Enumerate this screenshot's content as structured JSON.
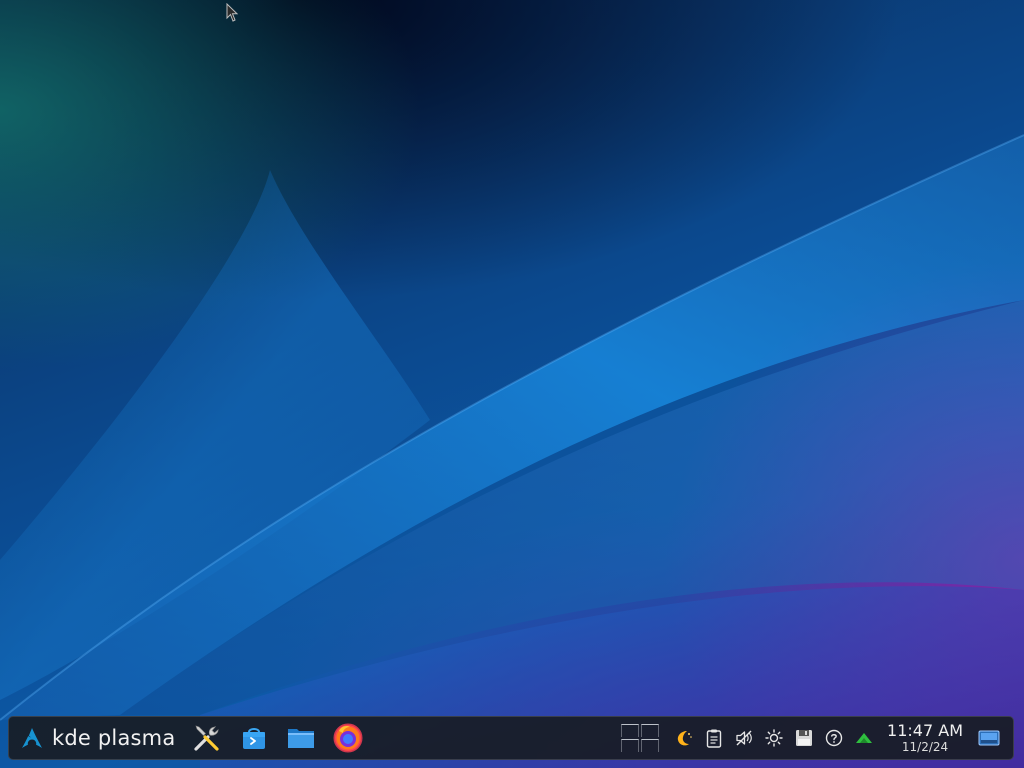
{
  "desktop": {
    "wallpaper": "kde-plasma-default-wallpaper",
    "colors": {
      "deep_blue": "#0b4a90",
      "bright_blue": "#1a8fe6",
      "teal": "#14786e",
      "magenta": "#961eaa"
    }
  },
  "taskbar": {
    "launcher": {
      "icon": "arch-linux-logo-icon",
      "label": "kde plasma"
    },
    "pinned_apps": [
      {
        "name": "system-settings",
        "icon": "wrench-screwdriver-icon"
      },
      {
        "name": "discover",
        "icon": "shopping-bag-icon"
      },
      {
        "name": "file-manager",
        "icon": "folder-icon"
      },
      {
        "name": "firefox",
        "icon": "firefox-icon"
      }
    ],
    "pager": {
      "desktops": 4
    },
    "tray": [
      {
        "name": "night-color",
        "icon": "moon-icon"
      },
      {
        "name": "clipboard",
        "icon": "clipboard-icon"
      },
      {
        "name": "volume-muted",
        "icon": "speaker-muted-icon"
      },
      {
        "name": "brightness",
        "icon": "sun-icon"
      },
      {
        "name": "storage",
        "icon": "floppy-disk-icon"
      },
      {
        "name": "help",
        "icon": "question-circle-icon"
      },
      {
        "name": "network",
        "icon": "network-up-icon"
      }
    ],
    "clock": {
      "time": "11:47 AM",
      "date": "11/2/24"
    },
    "show_desktop": {
      "icon": "show-desktop-icon"
    }
  }
}
